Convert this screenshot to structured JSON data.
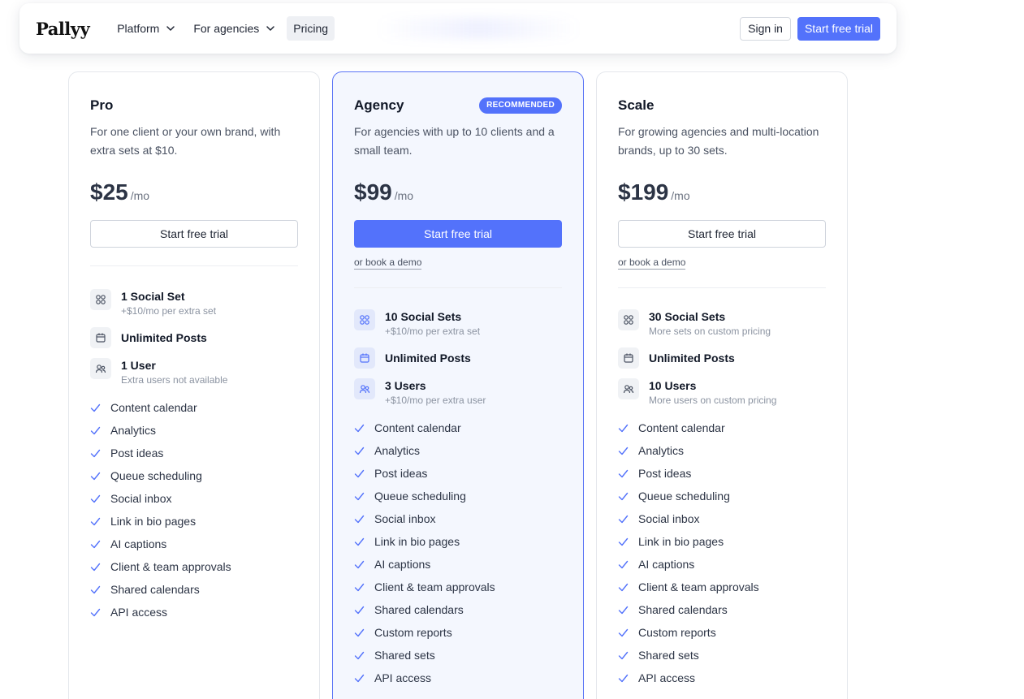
{
  "header": {
    "logo": "Pallyy",
    "nav": [
      {
        "label": "Platform",
        "dropdown": true
      },
      {
        "label": "For agencies",
        "dropdown": true
      },
      {
        "label": "Pricing",
        "dropdown": false
      }
    ],
    "sign_in": "Sign in",
    "start_trial": "Start free trial"
  },
  "colors": {
    "accent": "#5372fb",
    "featured_bg": "#f4f7fe",
    "check": "#5372fb"
  },
  "plans": [
    {
      "name": "Pro",
      "badge": "",
      "description": "For one client or your own brand, with extra sets at $10.",
      "price": "$25",
      "per": "/mo",
      "cta": "Start free trial",
      "demo": "",
      "quotas": [
        {
          "icon": "social-sets-icon",
          "name": "1 Social Set",
          "sub": "+$10/mo per extra set"
        },
        {
          "icon": "calendar-icon",
          "name": "Unlimited Posts",
          "sub": ""
        },
        {
          "icon": "users-icon",
          "name": "1 User",
          "sub": "Extra users not available"
        }
      ],
      "features": [
        "Content calendar",
        "Analytics",
        "Post ideas",
        "Queue scheduling",
        "Social inbox",
        "Link in bio pages",
        "AI captions",
        "Client & team approvals",
        "Shared calendars",
        "API access"
      ]
    },
    {
      "name": "Agency",
      "badge": "RECOMMENDED",
      "description": "For agencies with up to 10 clients and a small team.",
      "price": "$99",
      "per": "/mo",
      "cta": "Start free trial",
      "demo": "or book a demo",
      "quotas": [
        {
          "icon": "social-sets-icon",
          "name": "10 Social Sets",
          "sub": "+$10/mo per extra set"
        },
        {
          "icon": "calendar-icon",
          "name": "Unlimited Posts",
          "sub": ""
        },
        {
          "icon": "users-icon",
          "name": "3 Users",
          "sub": "+$10/mo per extra user"
        }
      ],
      "features": [
        "Content calendar",
        "Analytics",
        "Post ideas",
        "Queue scheduling",
        "Social inbox",
        "Link in bio pages",
        "AI captions",
        "Client & team approvals",
        "Shared calendars",
        "Custom reports",
        "Shared sets",
        "API access"
      ]
    },
    {
      "name": "Scale",
      "badge": "",
      "description": "For growing agencies and multi-location brands, up to 30 sets.",
      "price": "$199",
      "per": "/mo",
      "cta": "Start free trial",
      "demo": "or book a demo",
      "quotas": [
        {
          "icon": "social-sets-icon",
          "name": "30 Social Sets",
          "sub": "More sets on custom pricing"
        },
        {
          "icon": "calendar-icon",
          "name": "Unlimited Posts",
          "sub": ""
        },
        {
          "icon": "users-icon",
          "name": "10 Users",
          "sub": "More users on custom pricing"
        }
      ],
      "features": [
        "Content calendar",
        "Analytics",
        "Post ideas",
        "Queue scheduling",
        "Social inbox",
        "Link in bio pages",
        "AI captions",
        "Client & team approvals",
        "Shared calendars",
        "Custom reports",
        "Shared sets",
        "API access"
      ]
    }
  ]
}
